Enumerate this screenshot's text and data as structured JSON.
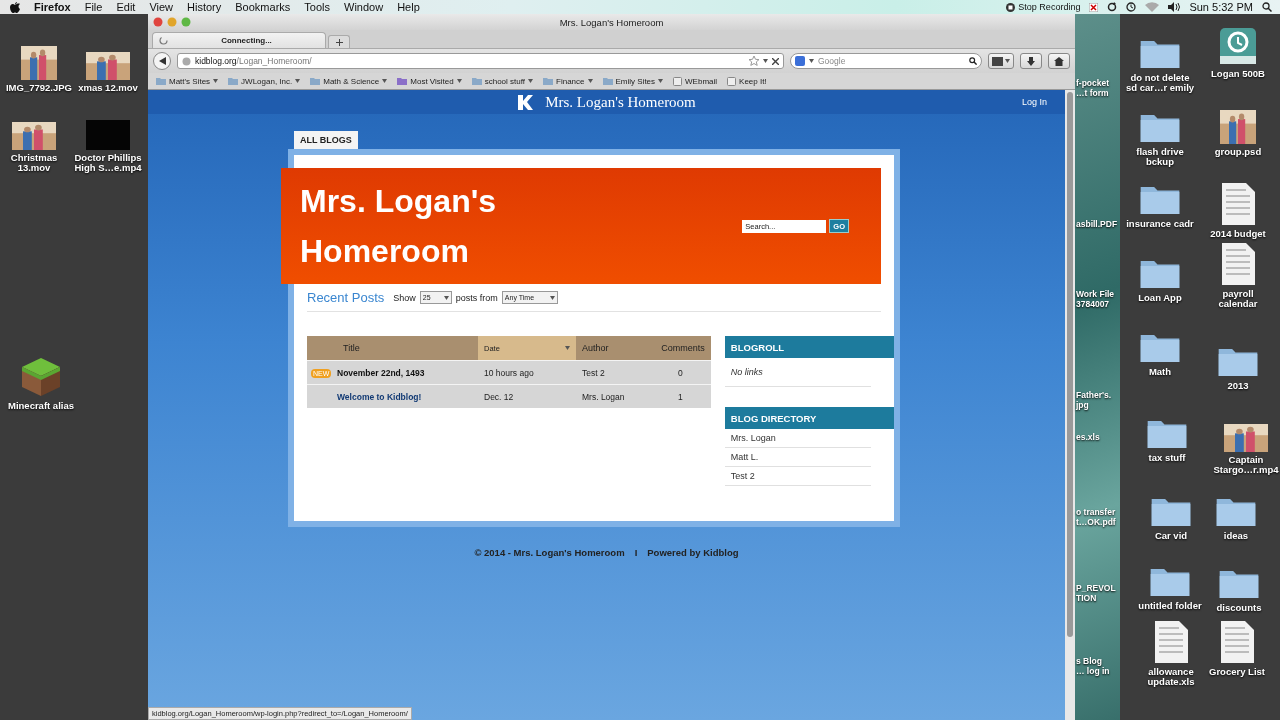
{
  "menubar": {
    "app": "Firefox",
    "menus": [
      "File",
      "Edit",
      "View",
      "History",
      "Bookmarks",
      "Tools",
      "Window",
      "Help"
    ],
    "recording": "Stop Recording",
    "clock": "Sun 5:32 PM"
  },
  "desktop_left": [
    {
      "label": "IMG_7792.JPG"
    },
    {
      "label": "xmas 12.mov",
      "kind": "video"
    },
    {
      "label": "Christmas\n13.mov",
      "kind": "video"
    },
    {
      "label": "Doctor Phillips\nHigh S…e.mp4",
      "kind": "dark-video"
    },
    {
      "label": "Minecraft alias",
      "kind": "block"
    }
  ],
  "browser": {
    "title": "Mrs. Logan's Homeroom",
    "tab": "Connecting...",
    "url": {
      "domain": "kidblog.org",
      "path": "/Logan_Homeroom/"
    },
    "search_placeholder": "Google",
    "bookmarks": [
      {
        "label": "Matt's Sites",
        "kind": "folder"
      },
      {
        "label": "JWLogan, Inc.",
        "kind": "folder"
      },
      {
        "label": "Math & Science",
        "kind": "folder"
      },
      {
        "label": "Most Visited",
        "kind": "smart"
      },
      {
        "label": "school stuff",
        "kind": "folder"
      },
      {
        "label": "Finance",
        "kind": "folder"
      },
      {
        "label": "Emily Sites",
        "kind": "folder"
      },
      {
        "label": "WEbmail",
        "kind": "page"
      },
      {
        "label": "Keep It!",
        "kind": "page"
      }
    ],
    "status_url": "kidblog.org/Logan_Homeroom/wp-login.php?redirect_to=/Logan_Homeroom/"
  },
  "page": {
    "site_title": "Mrs. Logan's Homeroom",
    "login": "Log In",
    "tab": "ALL BLOGS",
    "header_title": "Mrs. Logan's Homeroom",
    "search_placeholder": "Search...",
    "go": "GO",
    "recent_posts": {
      "heading": "Recent Posts",
      "show": "Show",
      "count": "25",
      "from": "posts from",
      "range": "Any Time"
    },
    "table": {
      "columns": [
        {
          "label": "Title",
          "sorted": false
        },
        {
          "label": "Date",
          "sorted": true
        },
        {
          "label": "Author",
          "sorted": false
        },
        {
          "label": "Comments",
          "sorted": false
        }
      ],
      "rows": [
        {
          "new": true,
          "badge": "NEW",
          "title": "November 22nd, 1493",
          "date": "10 hours ago",
          "author": "Test 2",
          "comments": "0"
        },
        {
          "new": false,
          "title": "Welcome to Kidblog!",
          "date": "Dec. 12",
          "author": "Mrs. Logan",
          "comments": "1"
        }
      ]
    },
    "blogroll": {
      "title": "BLOGROLL",
      "empty": "No links"
    },
    "directory": {
      "title": "BLOG DIRECTORY",
      "items": [
        "Mrs. Logan",
        "Matt L.",
        "Test 2"
      ]
    },
    "footer": {
      "copyright": "© 2014 - Mrs. Logan's Homeroom",
      "separator": "I",
      "powered": "Powered by Kidblog"
    }
  },
  "desktop_strip": [
    "f-pocket\n…t form",
    "asbill.PDF",
    "Work File\n3784007",
    "Father's.\njpg",
    "es.xls",
    "o transfer\nt…OK.pdf",
    "P_REVOL\nTION",
    "s Blog\n… log in"
  ],
  "desktop_right": [
    {
      "label": "do not delete\nsd car…r emily",
      "kind": "folder"
    },
    {
      "label": "Logan 500B",
      "kind": "drive"
    },
    {
      "label": "flash drive\nbckup",
      "kind": "folder"
    },
    {
      "label": "group.psd"
    },
    {
      "label": "insurance cadr",
      "kind": "folder"
    },
    {
      "label": "2014 budget",
      "kind": "sheet"
    },
    {
      "label": "Loan App",
      "kind": "folder"
    },
    {
      "label": "payroll\ncalendar",
      "kind": "doc"
    },
    {
      "label": "Math",
      "kind": "folder"
    },
    {
      "label": "2013",
      "kind": "folder"
    },
    {
      "label": "tax stuff",
      "kind": "folder"
    },
    {
      "label": "Captain\nStargo…r.mp4",
      "kind": "video"
    },
    {
      "label": "Car vid",
      "kind": "folder"
    },
    {
      "label": "ideas",
      "kind": "folder"
    },
    {
      "label": "untitled folder",
      "kind": "folder"
    },
    {
      "label": "discounts",
      "kind": "folder"
    },
    {
      "label": "allowance\nupdate.xls",
      "kind": "sheet"
    },
    {
      "label": "Grocery List",
      "kind": "pdf"
    }
  ]
}
